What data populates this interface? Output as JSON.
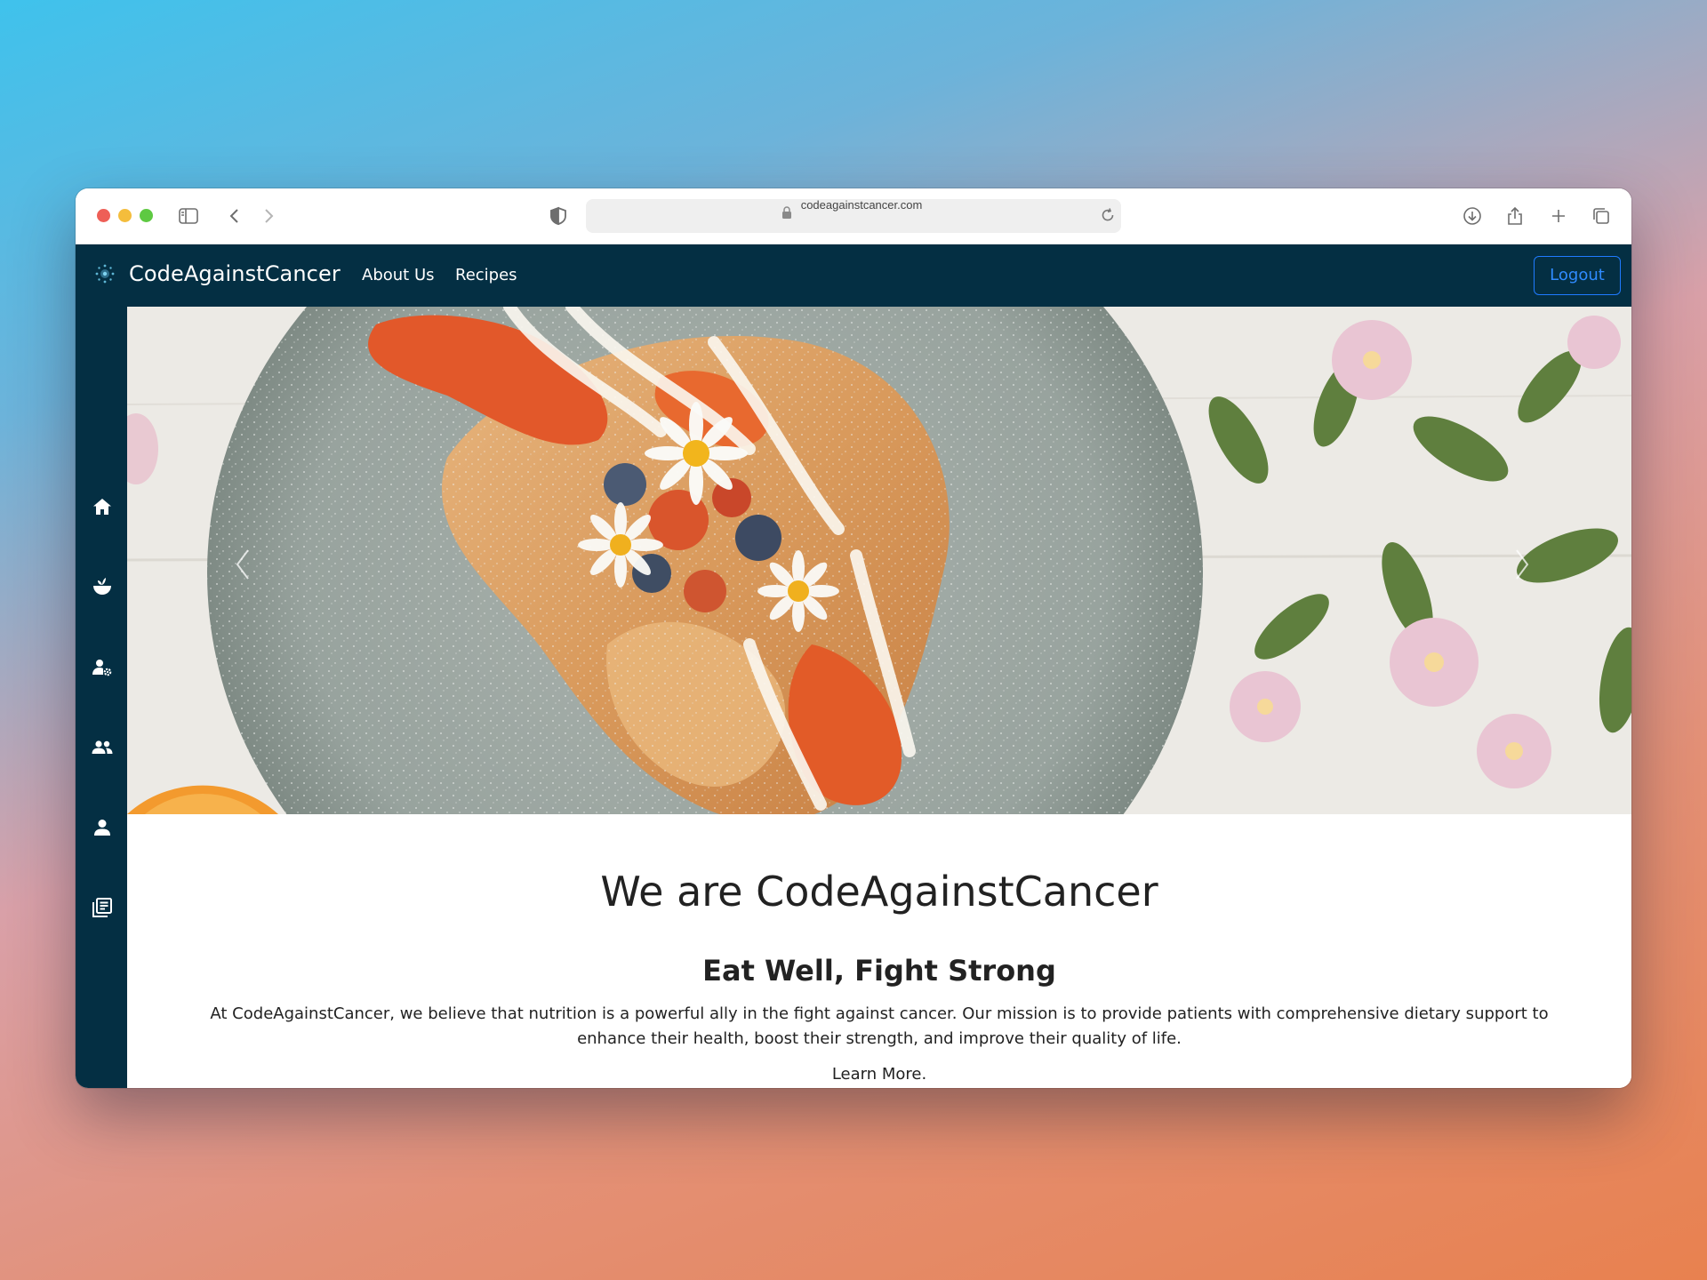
{
  "browser": {
    "url": "codeagainstcancer.com",
    "icons": [
      "sidebar-toggle-icon",
      "back-icon",
      "forward-icon",
      "shield-icon",
      "lock-icon",
      "reload-icon",
      "download-icon",
      "share-icon",
      "new-tab-icon",
      "tabs-overview-icon"
    ]
  },
  "navbar": {
    "brand": "CodeAgainstCancer",
    "links": [
      "About Us",
      "Recipes"
    ],
    "logout_label": "Logout",
    "accent_color": "#1f7bff",
    "background_color": "#042f43"
  },
  "sidebar": {
    "items": [
      "home-icon",
      "plant-icon",
      "user-settings-icon",
      "group-icon",
      "person-icon",
      "library-icon"
    ]
  },
  "hero": {
    "image": "french-toast-with-berries-and-daisies-photo",
    "controls": [
      "previous-slide-icon",
      "next-slide-icon"
    ]
  },
  "main": {
    "headline": "We are CodeAgainstCancer",
    "subheadline": "Eat Well, Fight Strong",
    "mission": "At CodeAgainstCancer, we believe that nutrition is a powerful ally in the fight against cancer. Our mission is to provide patients with comprehensive dietary support to enhance their health, boost their strength, and improve their quality of life.",
    "learn_more": "Learn More."
  }
}
